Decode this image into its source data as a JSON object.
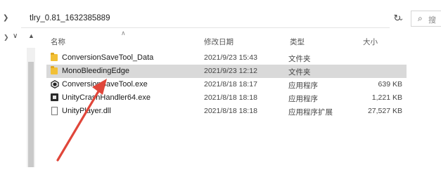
{
  "address": {
    "path": "tlry_0.81_1632385889",
    "dropdown_glyph": "⌄",
    "refresh_glyph": "↻",
    "search_placeholder": "搜"
  },
  "columns": {
    "name": "名称",
    "date": "修改日期",
    "type": "类型",
    "size": "大小"
  },
  "files": [
    {
      "name": "ConversionSaveTool_Data",
      "date": "2021/9/23 15:43",
      "type": "文件夹",
      "size": "",
      "icon": "folder-icon",
      "selected": false
    },
    {
      "name": "MonoBleedingEdge",
      "date": "2021/9/23 12:12",
      "type": "文件夹",
      "size": "",
      "icon": "folder-icon",
      "selected": true
    },
    {
      "name": "ConversionSaveTool.exe",
      "date": "2021/8/18 18:17",
      "type": "应用程序",
      "size": "639 KB",
      "icon": "unity-app-icon",
      "selected": false
    },
    {
      "name": "UnityCrashHandler64.exe",
      "date": "2021/8/18 18:18",
      "type": "应用程序",
      "size": "1,221 KB",
      "icon": "exe-icon",
      "selected": false
    },
    {
      "name": "UnityPlayer.dll",
      "date": "2021/8/18 18:18",
      "type": "应用程序扩展",
      "size": "27,527 KB",
      "icon": "dll-file-icon",
      "selected": false
    }
  ],
  "colors": {
    "selection": "#d9d9d9",
    "folder": "#f2c036",
    "annotation_arrow": "#e0463a"
  }
}
